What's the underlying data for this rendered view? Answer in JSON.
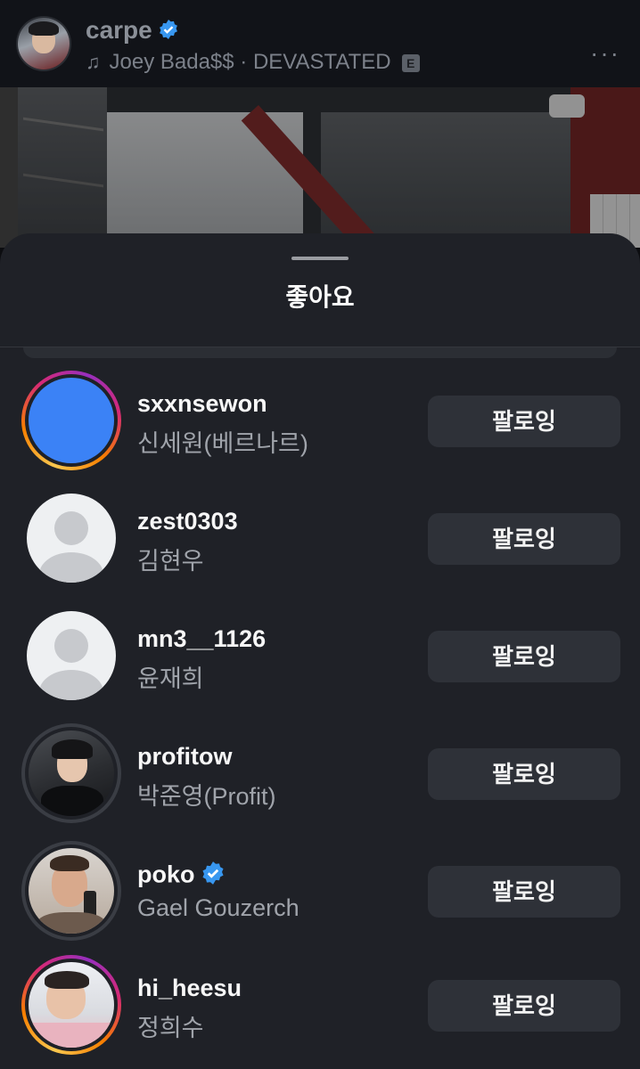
{
  "post": {
    "username": "carpe",
    "music": "Joey Bada$$ · DEVASTATED",
    "explicit_badge": "E",
    "more": "···"
  },
  "sheet": {
    "title": "좋아요"
  },
  "users": [
    {
      "handle": "sxxnsewon",
      "name": "신세원(베르나르)",
      "button": "팔로잉"
    },
    {
      "handle": "zest0303",
      "name": "김현우",
      "button": "팔로잉"
    },
    {
      "handle": "mn3__1126",
      "name": "윤재희",
      "button": "팔로잉"
    },
    {
      "handle": "profitow",
      "name": "박준영(Profit)",
      "button": "팔로잉"
    },
    {
      "handle": "poko",
      "name": "Gael Gouzerch",
      "button": "팔로잉"
    },
    {
      "handle": "hi_heesu",
      "name": "정희수",
      "button": "팔로잉"
    }
  ],
  "colors": {
    "verified": "#3897f0",
    "sheet_bg": "#1f2127",
    "button_bg": "#2e3138"
  }
}
